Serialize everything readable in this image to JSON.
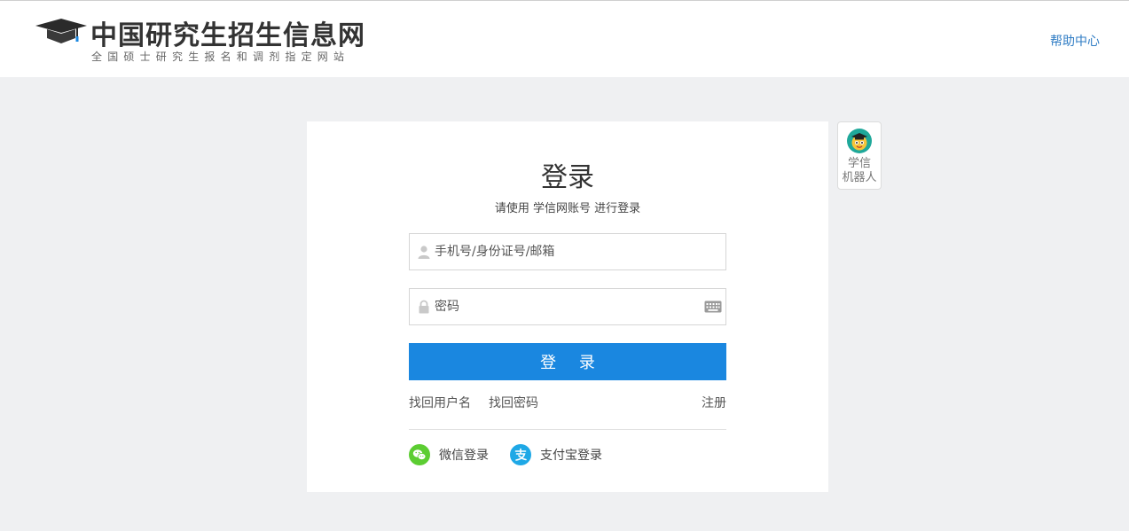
{
  "header": {
    "logo_title": "中国研究生招生信息网",
    "logo_subtitle": "全国硕士研究生报名和调剂指定网站",
    "help_link": "帮助中心"
  },
  "login": {
    "title": "登录",
    "subtitle": "请使用 学信网账号 进行登录",
    "username_placeholder": "手机号/身份证号/邮箱",
    "password_placeholder": "密码",
    "submit_label": "登 录",
    "forgot_username": "找回用户名",
    "forgot_password": "找回密码",
    "register": "注册",
    "wechat_login": "微信登录",
    "alipay_login": "支付宝登录"
  },
  "robot": {
    "label_line1": "学信",
    "label_line2": "机器人"
  },
  "colors": {
    "primary_button": "#1a87e0",
    "link": "#2f7cc4",
    "wechat": "#5ccd32",
    "alipay": "#1ea8e6",
    "background": "#eff0f2"
  },
  "icons": {
    "logo": "graduation-cap-icon",
    "username": "user-icon",
    "password": "lock-icon",
    "keyboard": "keyboard-icon",
    "wechat": "wechat-icon",
    "alipay": "alipay-icon",
    "robot": "robot-avatar-icon"
  }
}
